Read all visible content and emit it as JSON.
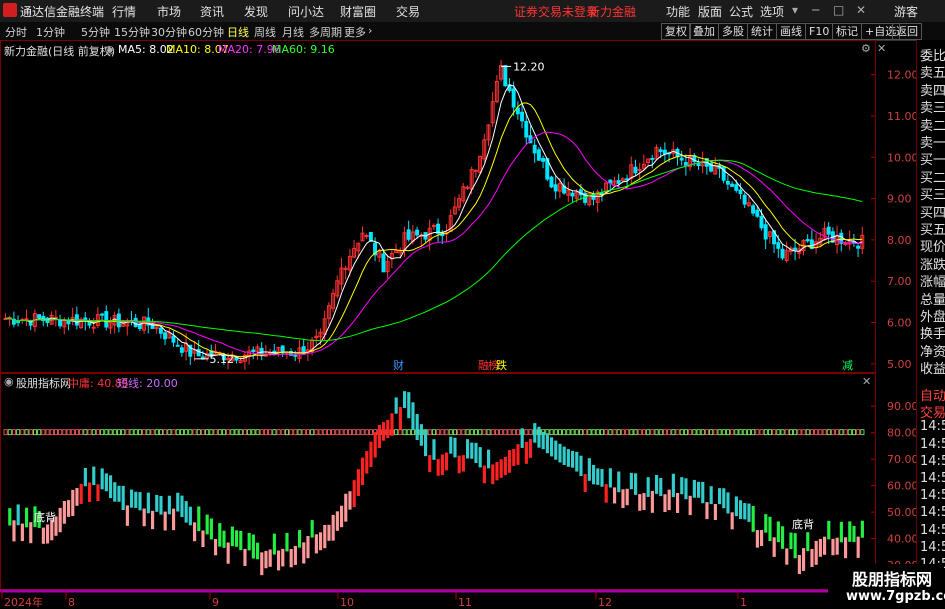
{
  "titlebar": {
    "app_title": "通达信金融终端",
    "menus": [
      "行情",
      "市场",
      "资讯",
      "发现",
      "问小达",
      "财富圈",
      "交易"
    ],
    "notice": "证券交易未登录",
    "stock": "新力金融",
    "right_menus": [
      "功能",
      "版面",
      "公式",
      "选项"
    ],
    "guest": "游客"
  },
  "periodbar": {
    "items": [
      "分时",
      "1分钟",
      "5分钟",
      "15分钟",
      "30分钟",
      "60分钟",
      "日线",
      "周线",
      "月线",
      "多周期",
      "更多"
    ],
    "active": "日线",
    "more_arrow": "›",
    "tools": [
      "复权",
      "叠加",
      "多股",
      "统计",
      "画线",
      "F10",
      "标记",
      "+自选",
      "返回"
    ]
  },
  "price_panel": {
    "stock_label": "新力金融(日线 前复权)",
    "ma5": "MA5: 8.02",
    "ma10": "MA10: 8.07",
    "ma20": "MA20: 7.96",
    "ma60": "MA60: 9.16",
    "high_label": "12.20",
    "low_label": "5.12",
    "event_cai": "财",
    "event_rong": "融",
    "event_bang": "榜",
    "event_die": "跌",
    "event_jian": "减",
    "y_ticks": [
      "12.00",
      "11.00",
      "10.00",
      "9.00",
      "8.00",
      "7.00",
      "6.00",
      "5.00"
    ],
    "colors": {
      "up": "#ff3232",
      "down": "#00e4ff",
      "ma5": "#ffffff",
      "ma10": "#ffff00",
      "ma20": "#ff00ff",
      "ma60": "#00ff00"
    }
  },
  "indicator_panel": {
    "name": "股朋指标网",
    "mid_label": "中庸: 40.85",
    "short_label": "短线: 20.00",
    "y_ticks": [
      "90.00",
      "80.00",
      "70.00",
      "60.00",
      "50.00",
      "40.00",
      "30.00"
    ],
    "label_left": "底背",
    "label_right": "底背"
  },
  "x_axis": {
    "labels": [
      "2024年",
      "8",
      "9",
      "10",
      "11",
      "12",
      "1"
    ]
  },
  "side_panel": {
    "items": [
      "委比",
      "卖五",
      "卖四",
      "卖三",
      "卖二",
      "卖一",
      "买一",
      "买二",
      "买三",
      "买四",
      "买五",
      "现价",
      "涨跌",
      "涨幅",
      "总量",
      "外盘",
      "换手",
      "净资",
      "收益"
    ],
    "lower_items": [
      "自动",
      "交易",
      "14:5",
      "14:5",
      "14:5",
      "14:5",
      "14:5",
      "14:5",
      "14:5",
      "14:5",
      "14:5"
    ]
  },
  "watermark": {
    "line1": "股朋指标网",
    "line2": "www.7gpzb.com"
  }
}
